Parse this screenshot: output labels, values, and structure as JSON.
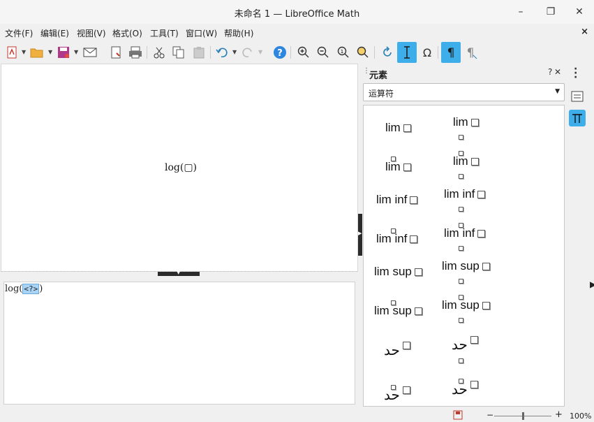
{
  "window": {
    "title": "未命名 1 — LibreOffice Math",
    "minimize": "–",
    "maximize": "❐",
    "close": "✕"
  },
  "menu": {
    "items": [
      "文件(F)",
      "编辑(E)",
      "视图(V)",
      "格式(O)",
      "工具(T)",
      "窗口(W)",
      "帮助(H)"
    ],
    "close": "×"
  },
  "toolbar": {
    "icons": [
      "new-document-icon",
      "open-folder-icon",
      "save-icon",
      "email-icon",
      "export-pdf-icon",
      "print-icon",
      "cut-icon",
      "copy-icon",
      "paste-icon",
      "undo-icon",
      "redo-icon",
      "help-icon",
      "zoom-in-icon",
      "zoom-out-icon",
      "zoom-fit-icon",
      "zoom-all-icon",
      "update-icon",
      "formula-cursor-icon",
      "symbols-icon",
      "elements-pilcrow-icon",
      "formula-text-icon"
    ],
    "active_color": "#3daee9"
  },
  "preview": {
    "formula": "log(▢)"
  },
  "editor": {
    "text_before": "log(",
    "placeholder": "<?>",
    "text_after": ")"
  },
  "sidebar": {
    "title": "元素",
    "help": "?",
    "close": "✕",
    "menu": "⋮",
    "category": "运算符",
    "elements": [
      {
        "label": "lim",
        "variant": "plain"
      },
      {
        "label": "lim",
        "variant": "upper"
      },
      {
        "label": "lim",
        "variant": "over"
      },
      {
        "label": "lim",
        "variant": "both"
      },
      {
        "label": "lim inf",
        "variant": "plain"
      },
      {
        "label": "lim inf",
        "variant": "upper"
      },
      {
        "label": "lim inf",
        "variant": "over"
      },
      {
        "label": "lim inf",
        "variant": "both"
      },
      {
        "label": "lim sup",
        "variant": "plain"
      },
      {
        "label": "lim sup",
        "variant": "upper"
      },
      {
        "label": "lim sup",
        "variant": "over"
      },
      {
        "label": "lim sup",
        "variant": "both"
      },
      {
        "label": "حد",
        "variant": "plain"
      },
      {
        "label": "حد",
        "variant": "upper"
      },
      {
        "label": "حد",
        "variant": "over"
      },
      {
        "label": "حد",
        "variant": "both"
      }
    ]
  },
  "statusbar": {
    "zoom": "100%",
    "zoom_minus": "−",
    "zoom_plus": "+"
  }
}
